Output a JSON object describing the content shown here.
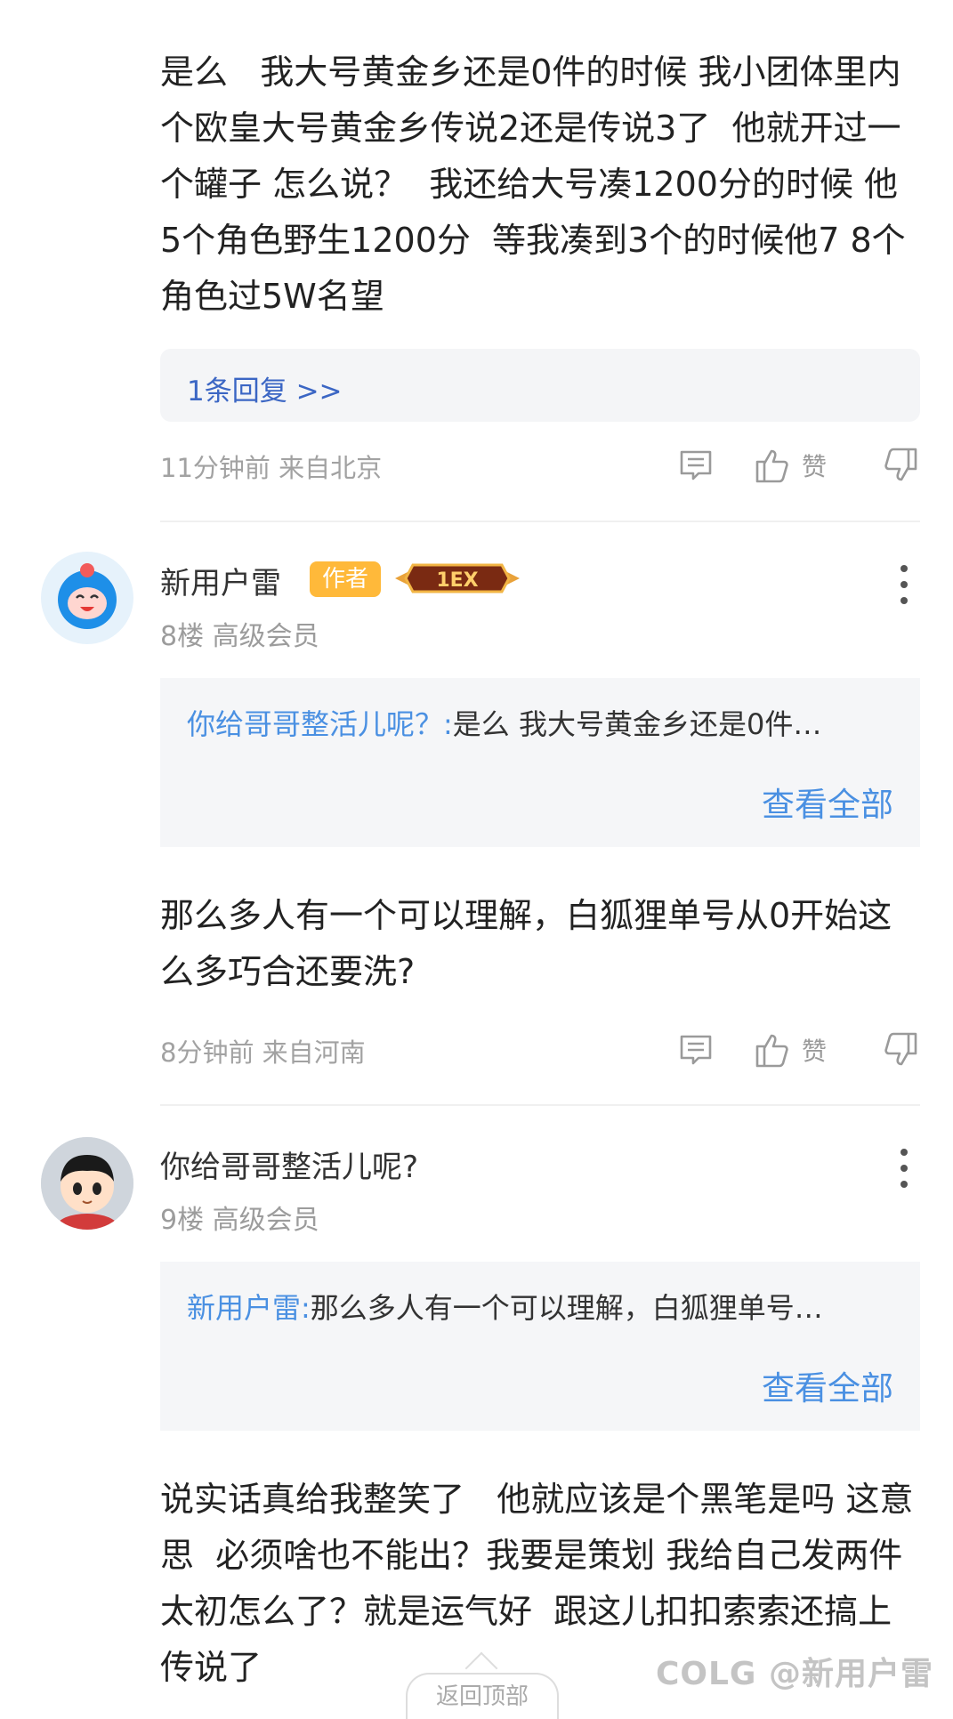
{
  "comments": [
    {
      "body": "是么   我大号黄金乡还是0件的时候 我小团体里内个欧皇大号黄金乡传说2还是传说3了  他就开过一个罐子 怎么说？  我还给大号凑1200分的时候 他5个角色野生1200分  等我凑到3个的时候他7 8个角色过5W名望",
      "reply_link": "1条回复 >>",
      "meta": "11分钟前 来自北京",
      "like_label": "赞"
    },
    {
      "username": "新用户雷",
      "author_badge": "作者",
      "level_badge": "1EX",
      "floor": "8楼 高级会员",
      "quote_name": "你给哥哥整活儿呢？:",
      "quote_text": "是么   我大号黄金乡还是0件…",
      "view_all": "查看全部",
      "body": "那么多人有一个可以理解，白狐狸单号从0开始这么多巧合还要洗?",
      "meta": "8分钟前 来自河南",
      "like_label": "赞"
    },
    {
      "username": "你给哥哥整活儿呢?",
      "floor": "9楼 高级会员",
      "quote_name": "新用户雷:",
      "quote_text": "那么多人有一个可以理解，白狐狸单号…",
      "view_all": "查看全部",
      "body": "说实话真给我整笑了   他就应该是个黑笔是吗 这意思  必须啥也不能出？我要是策划 我给自己发两件太初怎么了？就是运气好  跟这儿扣扣索索还搞上传说了"
    }
  ],
  "back_to_top": "返回顶部",
  "watermark": "COLG @新用户雷",
  "colors": {
    "link_blue": "#4a90e2",
    "reply_blue": "#3b66c4",
    "author_badge": "#ffb93a",
    "meta_gray": "#a2a2a2"
  },
  "icons": [
    "reply-icon",
    "thumbs-up-icon",
    "thumbs-down-icon",
    "more-vertical-icon"
  ]
}
